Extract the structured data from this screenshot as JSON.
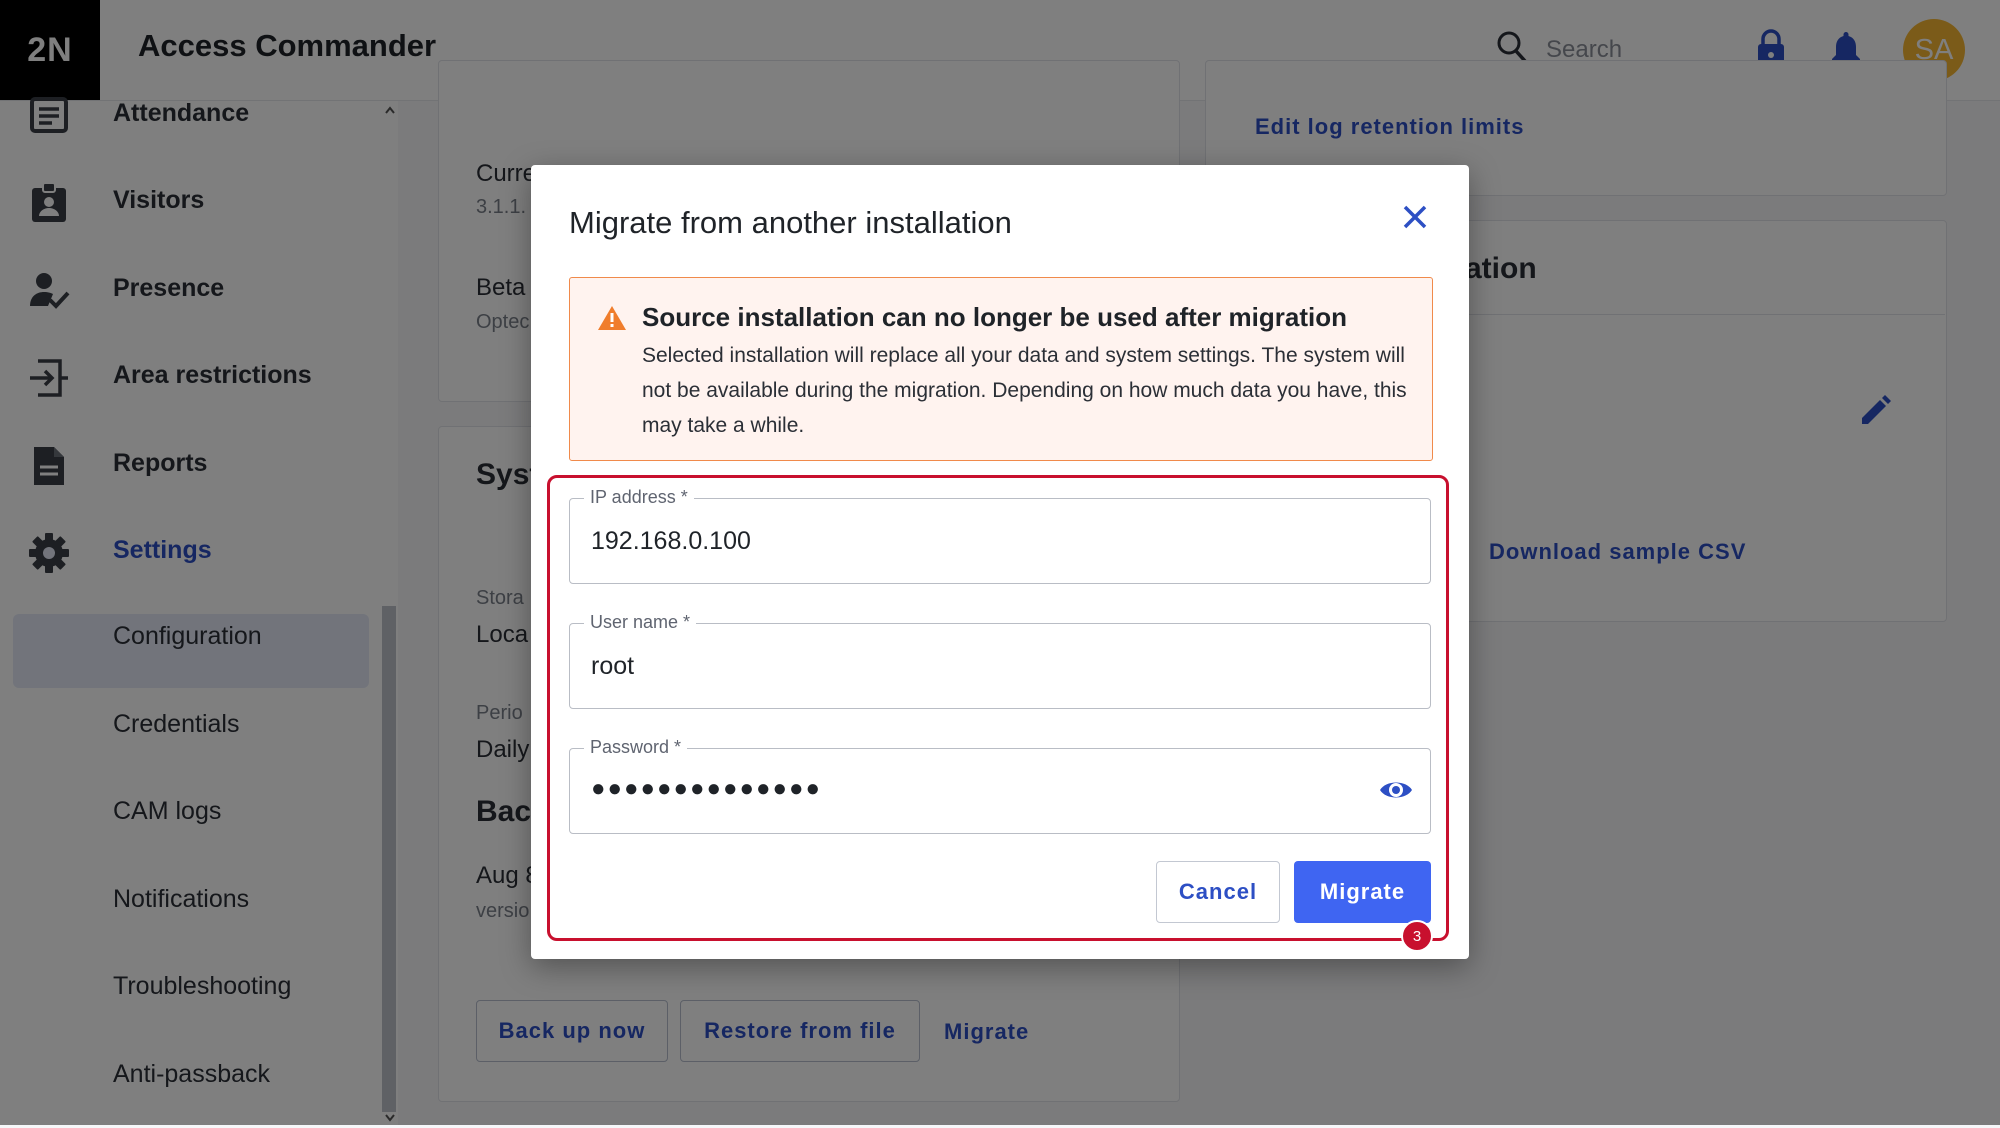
{
  "app": {
    "logo": "2N",
    "title": "Access Commander"
  },
  "topbar": {
    "search_placeholder": "Search",
    "avatar_initials": "SA",
    "avatar_color": "#f7b733"
  },
  "sidebar": {
    "items": [
      {
        "label": "Attendance",
        "icon": "attendance-icon"
      },
      {
        "label": "Visitors",
        "icon": "visitor-badge-icon"
      },
      {
        "label": "Presence",
        "icon": "person-check-icon"
      },
      {
        "label": "Area restrictions",
        "icon": "area-restrictions-icon"
      },
      {
        "label": "Reports",
        "icon": "report-document-icon"
      },
      {
        "label": "Settings",
        "icon": "gear-icon",
        "active": true
      }
    ],
    "subitems": [
      "Configuration",
      "Credentials",
      "CAM logs",
      "Notifications",
      "Troubleshooting",
      "Anti-passback"
    ]
  },
  "main": {
    "current_label": "Curre",
    "current_version": "3.1.1.",
    "beta_label": "Beta",
    "beta_sub": "Optec",
    "system_heading": "Syst",
    "storage_label": "Stora",
    "storage_value": "Loca",
    "period_label": "Perio",
    "period_value": "Daily",
    "backup_heading": "Bac",
    "backup_date": "Aug 8",
    "backup_version": "versio",
    "back_up_now": "Back up now",
    "restore_from_file": "Restore from file",
    "migrate_link": "Migrate",
    "edit_log_retention": "Edit log retention limits",
    "right_heading": "ation",
    "download_sample_csv": "Download sample CSV"
  },
  "dialog": {
    "title": "Migrate from another installation",
    "warning_title": "Source installation can no longer be used after migration",
    "warning_body": "Selected installation will replace all your data and system settings. The system will not be available during the migration. Depending on how much data you have, this may take a while.",
    "fields": {
      "ip": {
        "label": "IP address *",
        "value": "192.168.0.100"
      },
      "user": {
        "label": "User name *",
        "value": "root"
      },
      "password": {
        "label": "Password *",
        "value": "●●●●●●●●●●●●●●"
      }
    },
    "cancel": "Cancel",
    "migrate": "Migrate",
    "step_badge": "3"
  },
  "colors": {
    "accent": "#3f65f2",
    "link": "#2d4fc4",
    "highlight": "#c8102e",
    "warning": "#f08a4b"
  }
}
